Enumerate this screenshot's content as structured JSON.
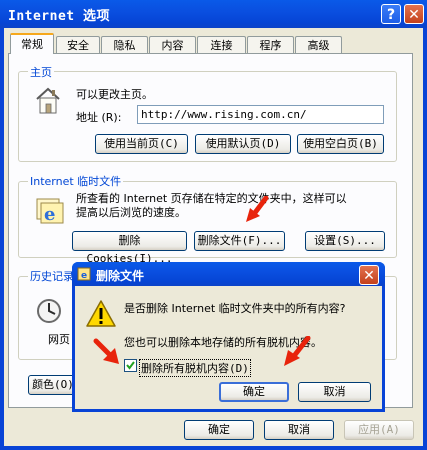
{
  "window": {
    "title": "Internet 选项",
    "help": "?",
    "close": "✕"
  },
  "tabs": [
    "常规",
    "安全",
    "隐私",
    "内容",
    "连接",
    "程序",
    "高级"
  ],
  "homepage": {
    "group_title": "主页",
    "desc": "可以更改主页。",
    "address_label": "地址 (R):",
    "address_value": "http://www.rising.com.cn/",
    "buttons": [
      "使用当前页(C)",
      "使用默认页(D)",
      "使用空白页(B)"
    ]
  },
  "temp_files": {
    "group_title": "Internet 临时文件",
    "desc_line1": "所查看的 Internet 页存储在特定的文件夹中，这样可以",
    "desc_line2": "提高以后浏览的速度。",
    "buttons": [
      "删除 Cookies(I)...",
      "删除文件(F)...",
      "设置(S)..."
    ]
  },
  "history": {
    "group_title": "历史记录",
    "desc": "网页"
  },
  "bottom_left_buttons": [
    "颜色(O)"
  ],
  "footer_buttons": [
    "确定",
    "取消",
    "应用(A)"
  ],
  "dialog": {
    "title": "删除文件",
    "close": "✕",
    "question": "是否删除 Internet 临时文件夹中的所有内容?",
    "note": "您也可以删除本地存储的所有脱机内容。",
    "checkbox_label": "删除所有脱机内容(D)",
    "checkbox_checked": true,
    "ok": "确定",
    "cancel": "取消"
  },
  "colors": {
    "title_bar": "#0a4fe0",
    "face": "#ece9d8",
    "arrow": "#e8240c",
    "link_blue": "#0046d5"
  }
}
